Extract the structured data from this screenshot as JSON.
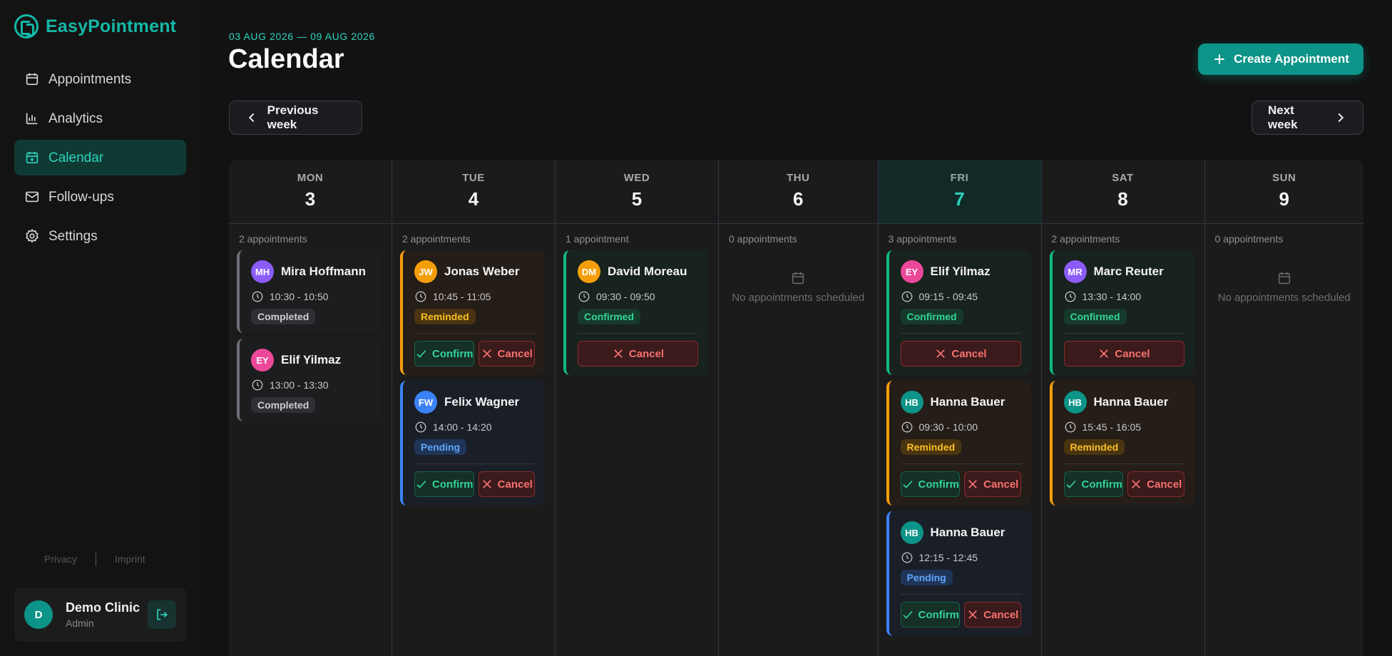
{
  "app": {
    "name": "EasyPointment"
  },
  "sidebar": {
    "items": [
      {
        "label": "Appointments",
        "icon": "calendar-icon"
      },
      {
        "label": "Analytics",
        "icon": "bar-chart-icon"
      },
      {
        "label": "Calendar",
        "icon": "calendar-plus-icon",
        "active": true
      },
      {
        "label": "Follow-ups",
        "icon": "mail-icon"
      },
      {
        "label": "Settings",
        "icon": "gear-icon"
      }
    ],
    "footer_links": {
      "privacy": "Privacy",
      "imprint": "Imprint"
    },
    "user": {
      "initial": "D",
      "name": "Demo Clinic",
      "role": "Admin"
    }
  },
  "header": {
    "range": "03 AUG 2026 — 09 AUG 2026",
    "title": "Calendar",
    "create_label": "Create Appointment",
    "prev_label": "Previous week",
    "next_label": "Next week"
  },
  "colors": {
    "accent": "#14b8a6",
    "today_bg": "#112a27",
    "completed": "#6b6f75",
    "reminded": "#f59e0b",
    "confirmed": "#10b981",
    "pending": "#3b82f6"
  },
  "labels": {
    "confirm": "Confirm",
    "cancel": "Cancel",
    "empty": "No appointments scheduled"
  },
  "days": [
    {
      "name": "MON",
      "num": "3",
      "count": "2 appointments",
      "appointments": [
        {
          "initials": "MH",
          "name": "Mira Hoffmann",
          "time": "10:30 - 10:50",
          "status": "Completed"
        },
        {
          "initials": "EY",
          "name": "Elif Yilmaz",
          "time": "13:00 - 13:30",
          "status": "Completed"
        }
      ]
    },
    {
      "name": "TUE",
      "num": "4",
      "count": "2 appointments",
      "appointments": [
        {
          "initials": "JW",
          "name": "Jonas Weber",
          "time": "10:45 - 11:05",
          "status": "Reminded"
        },
        {
          "initials": "FW",
          "name": "Felix Wagner",
          "time": "14:00 - 14:20",
          "status": "Pending"
        }
      ]
    },
    {
      "name": "WED",
      "num": "5",
      "count": "1 appointment",
      "appointments": [
        {
          "initials": "DM",
          "name": "David Moreau",
          "time": "09:30 - 09:50",
          "status": "Confirmed"
        }
      ]
    },
    {
      "name": "THU",
      "num": "6",
      "count": "0 appointments",
      "appointments": []
    },
    {
      "name": "FRI",
      "num": "7",
      "count": "3 appointments",
      "today": true,
      "appointments": [
        {
          "initials": "EY",
          "name": "Elif Yilmaz",
          "time": "09:15 - 09:45",
          "status": "Confirmed"
        },
        {
          "initials": "HB",
          "name": "Hanna Bauer",
          "time": "09:30 - 10:00",
          "status": "Reminded"
        },
        {
          "initials": "HB",
          "name": "Hanna Bauer",
          "time": "12:15 - 12:45",
          "status": "Pending"
        }
      ]
    },
    {
      "name": "SAT",
      "num": "8",
      "count": "2 appointments",
      "appointments": [
        {
          "initials": "MR",
          "name": "Marc Reuter",
          "time": "13:30 - 14:00",
          "status": "Confirmed"
        },
        {
          "initials": "HB",
          "name": "Hanna Bauer",
          "time": "15:45 - 16:05",
          "status": "Reminded"
        }
      ]
    },
    {
      "name": "SUN",
      "num": "9",
      "count": "0 appointments",
      "appointments": []
    }
  ]
}
